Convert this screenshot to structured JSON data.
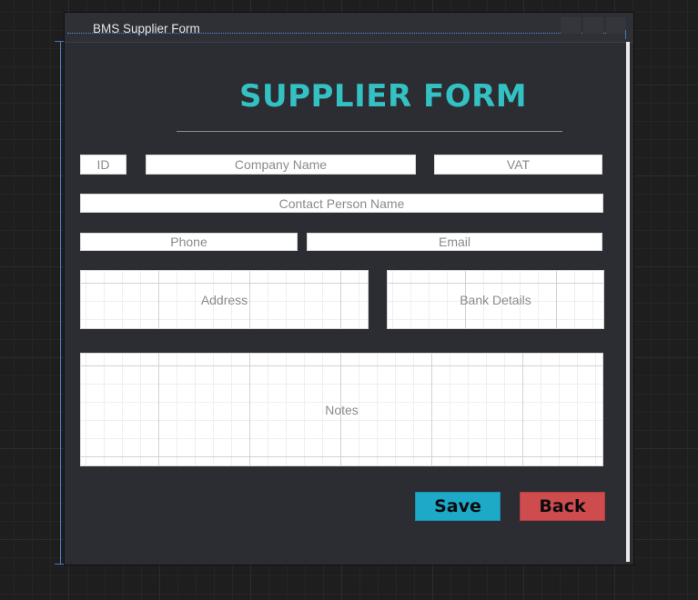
{
  "window": {
    "title": "BMS Supplier Form",
    "controls": {
      "minimize": "–",
      "maximize": "□",
      "close": "✕"
    }
  },
  "form": {
    "heading": "SUPPLIER FORM",
    "fields": {
      "id": "ID",
      "company_name": "Company Name",
      "vat": "VAT",
      "contact_person_name": "Contact Person Name",
      "phone": "Phone",
      "email": "Email",
      "address": "Address",
      "bank_details": "Bank Details",
      "notes": "Notes"
    },
    "buttons": {
      "save": "Save",
      "back": "Back"
    }
  },
  "colors": {
    "heading": "#33c1c3",
    "save_button": "#1ea9c9",
    "back_button": "#cf4c4e",
    "window_background": "#2b2d33"
  }
}
